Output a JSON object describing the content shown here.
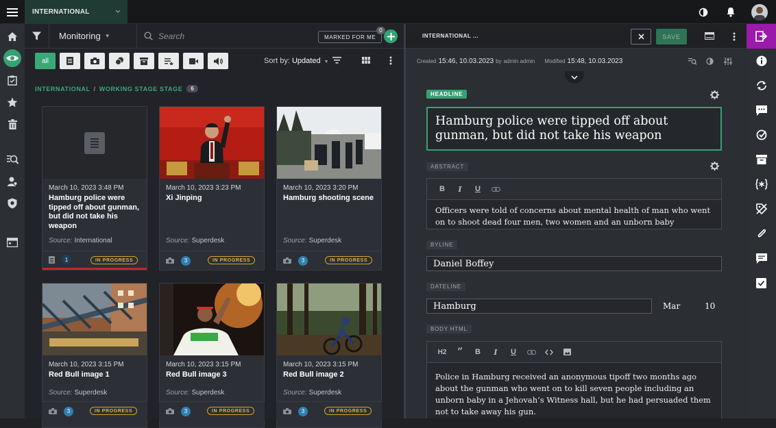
{
  "topbar": {
    "desk": "INTERNATIONAL"
  },
  "monitoring": {
    "title": "Monitoring",
    "search_placeholder": "Search",
    "marked_for_me": "MARKED FOR ME",
    "marked_count": "0",
    "filters": {
      "all": "all"
    },
    "sort_label": "Sort by:",
    "sort_value": "Updated",
    "breadcrumb": {
      "desk": "INTERNATIONAL",
      "sep": "/",
      "stage": "WORKING STAGE STAGE",
      "count": "6"
    }
  },
  "cards": [
    {
      "date": "March 10, 2023 3:48 PM",
      "title": "Hamburg police were tipped off about gunman, but did not take his weapon",
      "source_label": "Source:",
      "source": "International",
      "count": "1",
      "state": "IN PROGRESS",
      "type_icon": "text-icon"
    },
    {
      "date": "March 10, 2023 3:23 PM",
      "title": "Xi Jinping",
      "source_label": "Source:",
      "source": "Superdesk",
      "count": "3",
      "state": "IN PROGRESS",
      "type_icon": "camera-icon"
    },
    {
      "date": "March 10, 2023 3:20 PM",
      "title": "Hamburg shooting scene",
      "source_label": "Source:",
      "source": "Superdesk",
      "count": "3",
      "state": "IN PROGRESS",
      "type_icon": "camera-icon"
    },
    {
      "date": "March 10, 2023 3:15 PM",
      "title": "Red Bull image 1",
      "source_label": "Source:",
      "source": "Superdesk",
      "count": "3",
      "state": "IN PROGRESS",
      "type_icon": "camera-icon"
    },
    {
      "date": "March 10, 2023 3:15 PM",
      "title": "Red Bull image 3",
      "source_label": "Source:",
      "source": "Superdesk",
      "count": "3",
      "state": "IN PROGRESS",
      "type_icon": "camera-icon"
    },
    {
      "date": "March 10, 2023 3:15 PM",
      "title": "Red Bull image 2",
      "source_label": "Source:",
      "source": "Superdesk",
      "count": "3",
      "state": "IN PROGRESS",
      "type_icon": "camera-icon"
    }
  ],
  "editor": {
    "desk": "INTERNATIONAL ...",
    "save": "SAVE",
    "created_label": "Created",
    "created_value": "15:46, 10.03.2023",
    "by_label": "by",
    "author": "admin admin",
    "modified_label": "Modified",
    "modified_value": "15:48, 10.03.2023",
    "headline_label": "HEADLINE",
    "headline": "Hamburg police were tipped off about gunman, but did not take his weapon",
    "abstract_label": "ABSTRACT",
    "abstract": "Officers were told of concerns about mental health of man who went on to shoot dead four men, two women and an unborn baby",
    "byline_label": "BYLINE",
    "byline": "Daniel Boffey",
    "dateline_label": "DATELINE",
    "dateline_city": "Hamburg",
    "dateline_month": "Mar",
    "dateline_day": "10",
    "body_label": "BODY HTML",
    "body": "Police in Hamburg received an anonymous tipoff two months ago about the gunman  who went on to kill seven people including an unborn baby in a Jehovah’s Witness hall, but he had persuaded them not to take away his  gun."
  },
  "colors": {
    "accent": "#36a173",
    "active_nav": "#9a1aa9",
    "state": "#d7a52a",
    "selected": "#c5242c"
  }
}
